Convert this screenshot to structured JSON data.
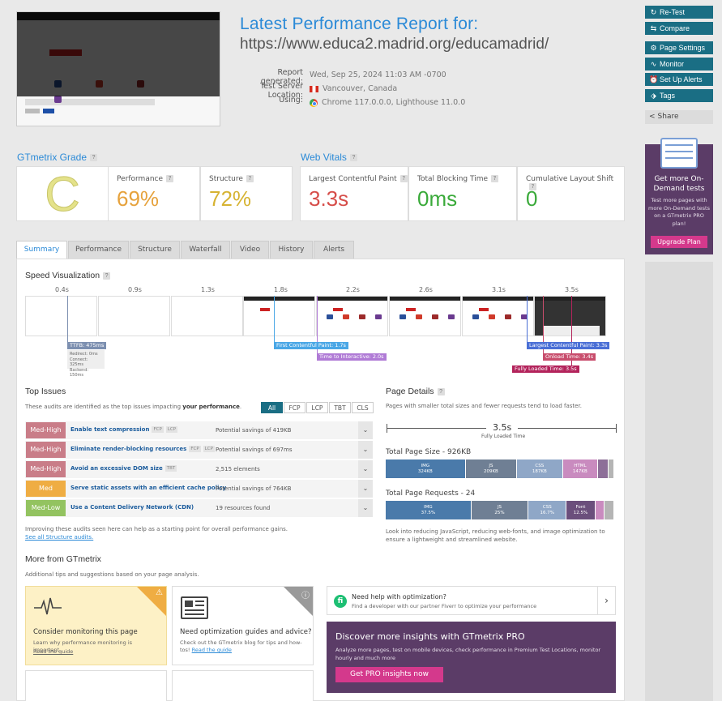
{
  "header": {
    "title": "Latest Performance Report for:",
    "url": "https://www.educa2.madrid.org/educamadrid/",
    "meta": [
      {
        "label": "Report generated:",
        "value": "Wed, Sep 25, 2024 11:03 AM -0700"
      },
      {
        "label": "Test Server Location:",
        "value": "Vancouver, Canada"
      },
      {
        "label": "Using:",
        "value": "Chrome 117.0.0.0, Lighthouse 11.0.0"
      }
    ]
  },
  "actions": [
    "Re-Test",
    "Compare",
    "Page Settings",
    "Monitor",
    "Set Up Alerts",
    "Tags"
  ],
  "share_label": "Share",
  "promo": {
    "title": "Get more On-Demand tests",
    "text": "Test more pages with more On-Demand tests on a GTmetrix PRO plan!",
    "button": "Upgrade Plan"
  },
  "grade": {
    "heading": "GTmetrix Grade",
    "letter": "C",
    "performance_label": "Performance",
    "performance": "69%",
    "structure_label": "Structure",
    "structure": "72%"
  },
  "vitals": {
    "heading": "Web Vitals",
    "lcp_label": "Largest Contentful Paint",
    "lcp": "3.3s",
    "tbt_label": "Total Blocking Time",
    "tbt": "0ms",
    "cls_label": "Cumulative Layout Shift",
    "cls": "0"
  },
  "tabs": [
    "Summary",
    "Performance",
    "Structure",
    "Waterfall",
    "Video",
    "History",
    "Alerts"
  ],
  "speed": {
    "heading": "Speed Visualization",
    "ticks": [
      "0.4s",
      "0.9s",
      "1.3s",
      "1.8s",
      "2.2s",
      "2.6s",
      "3.1s",
      "3.5s"
    ],
    "ttfb": "TTFB: 475ms",
    "ttfb_details": [
      "Redirect: 0ms",
      "Connect: 325ms",
      "Backend: 150ms"
    ],
    "fcp": "First Contentful Paint: 1.7s",
    "tti": "Time to Interactive: 2.0s",
    "lcp": "Largest Contentful Paint: 3.3s",
    "onload": "Onload Time: 3.4s",
    "fully": "Fully Loaded Time: 3.5s"
  },
  "issues": {
    "heading": "Top Issues",
    "desc_a": "These audits are identified as the top issues impacting ",
    "desc_b": "your performance",
    "desc_c": ".",
    "filters": [
      "All",
      "FCP",
      "LCP",
      "TBT",
      "CLS"
    ],
    "rows": [
      {
        "impact": "Med-High",
        "name": "Enable text compression",
        "chips": [
          "FCP",
          "LCP"
        ],
        "savings": "Potential savings of 419KB"
      },
      {
        "impact": "Med-High",
        "name": "Eliminate render-blocking resources",
        "chips": [
          "FCP",
          "LCP"
        ],
        "savings": "Potential savings of 697ms"
      },
      {
        "impact": "Med-High",
        "name": "Avoid an excessive DOM size",
        "chips": [
          "TBT"
        ],
        "savings": "2,515 elements"
      },
      {
        "impact": "Med",
        "name": "Serve static assets with an efficient cache policy",
        "chips": [],
        "savings": "Potential savings of 764KB"
      },
      {
        "impact": "Med-Low",
        "name": "Use a Content Delivery Network (CDN)",
        "chips": [],
        "savings": "19 resources found"
      }
    ],
    "footer": "Improving these audits seen here can help as a starting point for overall performance gains.",
    "footer_link": "See all Structure audits."
  },
  "page_details": {
    "heading": "Page Details",
    "desc": "Pages with smaller total sizes and fewer requests tend to load faster.",
    "fully_value": "3.5s",
    "fully_label": "Fully Loaded Time",
    "size_heading": "Total Page Size - 926KB",
    "size_segments": [
      {
        "name": "IMG",
        "value": "324KB",
        "share": 35,
        "color": "#4a7aaa"
      },
      {
        "name": "JS",
        "value": "209KB",
        "share": 22.5,
        "color": "#6f7f94"
      },
      {
        "name": "CSS",
        "value": "187KB",
        "share": 20,
        "color": "#8fa7c7"
      },
      {
        "name": "HTML",
        "value": "147KB",
        "share": 15.5,
        "color": "#c98bbf"
      },
      {
        "name": "",
        "value": "",
        "share": 4.5,
        "color": "#8d6f98"
      },
      {
        "name": "",
        "value": "",
        "share": 2.5,
        "color": "#b5b5b5"
      }
    ],
    "req_heading": "Total Page Requests - 24",
    "req_segments": [
      {
        "name": "IMG",
        "value": "37.5%",
        "share": 37.5,
        "color": "#4a7aaa"
      },
      {
        "name": "JS",
        "value": "25%",
        "share": 25,
        "color": "#6f7f94"
      },
      {
        "name": "CSS",
        "value": "16.7%",
        "share": 16.7,
        "color": "#8fa7c7"
      },
      {
        "name": "Font",
        "value": "12.5%",
        "share": 12.5,
        "color": "#6b4f7c"
      },
      {
        "name": "",
        "value": "",
        "share": 4.2,
        "color": "#c98bbf"
      },
      {
        "name": "",
        "value": "",
        "share": 4.1,
        "color": "#b5b5b5"
      }
    ],
    "footer": "Look into reducing JavaScript, reducing web-fonts, and image optimization to ensure a lightweight and streamlined website."
  },
  "more": {
    "heading": "More from GTmetrix",
    "desc": "Additional tips and suggestions based on your page analysis.",
    "monitor_title": "Consider monitoring this page",
    "monitor_desc": "Learn why performance monitoring is important.",
    "read_guide": "Read the guide",
    "guides_title": "Need optimization guides and advice?",
    "guides_desc": "Check out the GTmetrix blog for tips and how-tos!",
    "fiverr_title": "Need help with optimization?",
    "fiverr_desc": "Find a developer with our partner Fiverr to optimize your performance",
    "pro_title": "Discover more insights with GTmetrix PRO",
    "pro_desc": "Analyze more pages, test on mobile devices, check performance in Premium Test Locations, monitor hourly and much more",
    "pro_button": "Get PRO insights now"
  },
  "colors": {
    "accent": "#2b8ad7",
    "button": "#1a6e84",
    "med_high": "#c97d88",
    "med": "#efad43",
    "med_low": "#93c360",
    "performance": "#e6a23c",
    "structure": "#d6b332",
    "lcp": "#d64d49",
    "good": "#3aaa3a"
  }
}
